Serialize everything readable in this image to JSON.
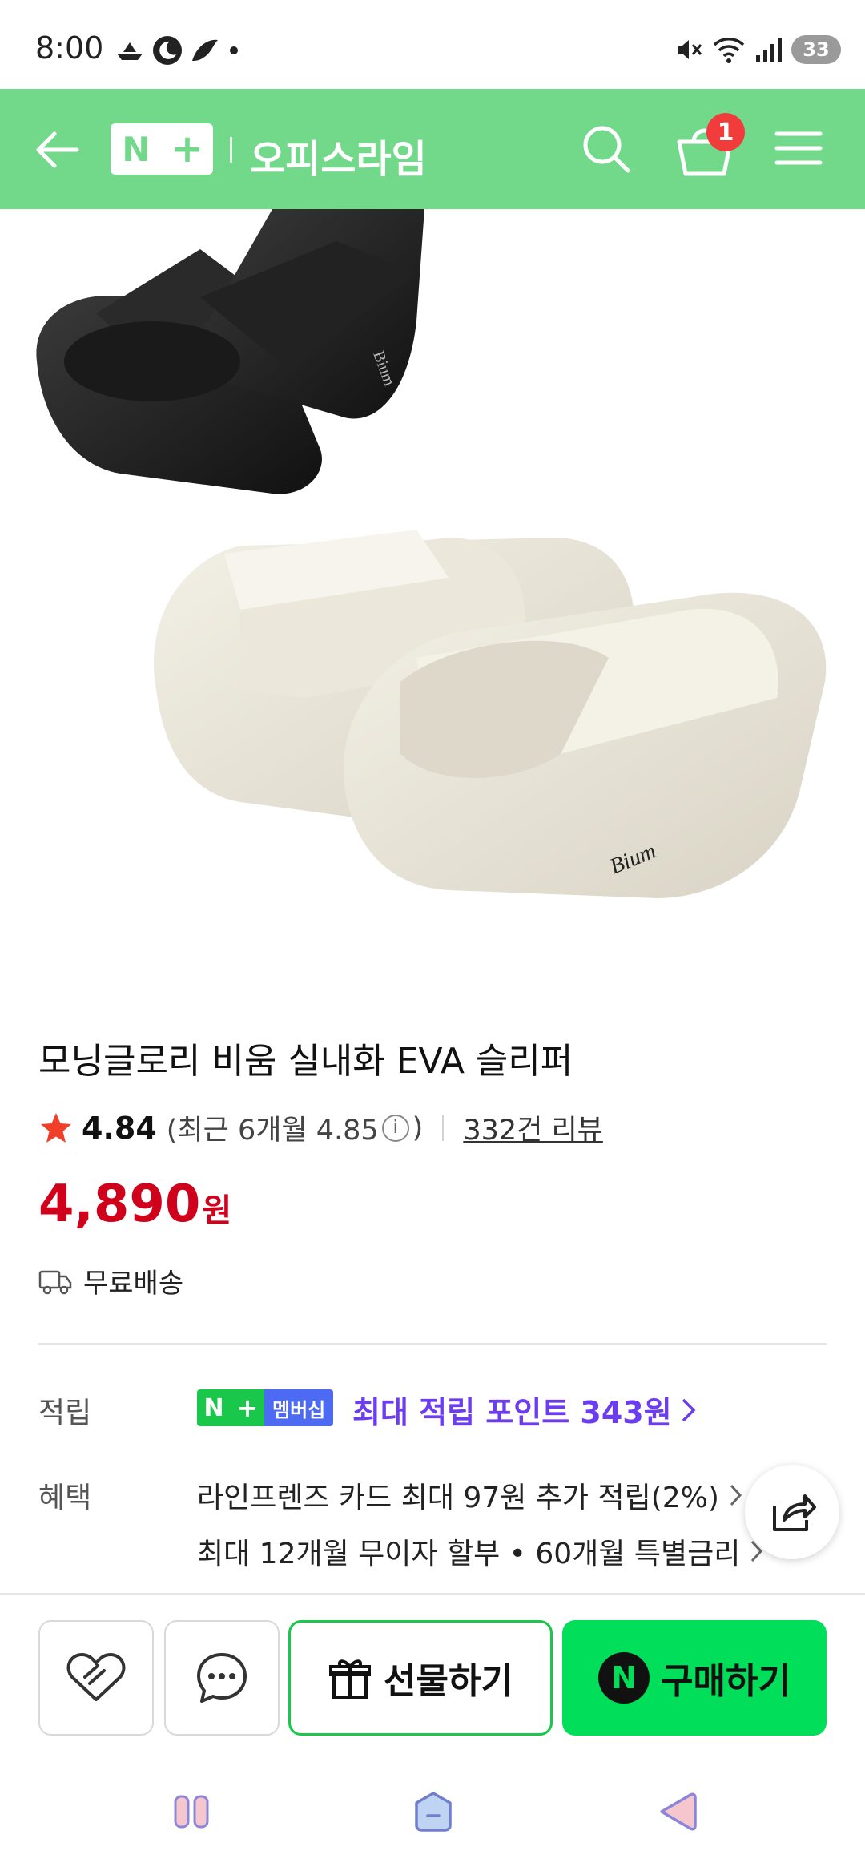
{
  "status_bar": {
    "time": "8:00",
    "battery": "33",
    "icons": [
      "boat-icon",
      "moon-icon",
      "bird-icon",
      "dot-icon",
      "mute-icon",
      "wifi-icon",
      "signal-icon"
    ]
  },
  "header": {
    "logo_n": "N",
    "logo_plus": "+",
    "store_name": "오피스라임",
    "cart_count": "1",
    "accent_color": "#72d98b"
  },
  "product": {
    "image_brand_text_top": "Bium",
    "image_brand_text_bottom": "Bium",
    "title": "모닝글로리 비움 실내화 EVA 슬리퍼",
    "rating": "4.84",
    "rating_recent": "(최근 6개월 4.85",
    "rating_recent_close": ")",
    "info_glyph": "i",
    "reviews": "332건 리뷰",
    "price": "4,890",
    "price_unit": "원",
    "shipping": "무료배송"
  },
  "points": {
    "label": "적립",
    "badge_n": "N",
    "badge_plus": "+",
    "badge_text": "멤버십",
    "text": "최대 적립 포인트 343원"
  },
  "benefits": {
    "label": "혜택",
    "line1": "라인프렌즈 카드 최대 97원 추가 적립(2%)",
    "line2": "최대 12개월 무이자 할부 • 60개월 특별금리"
  },
  "actions": {
    "gift_label": "선물하기",
    "buy_label": "구매하기",
    "npay_glyph": "N"
  },
  "colors": {
    "price": "#d0021b",
    "points": "#6b3cf0",
    "buy": "#00de5a",
    "gift_border": "#19c84a"
  }
}
